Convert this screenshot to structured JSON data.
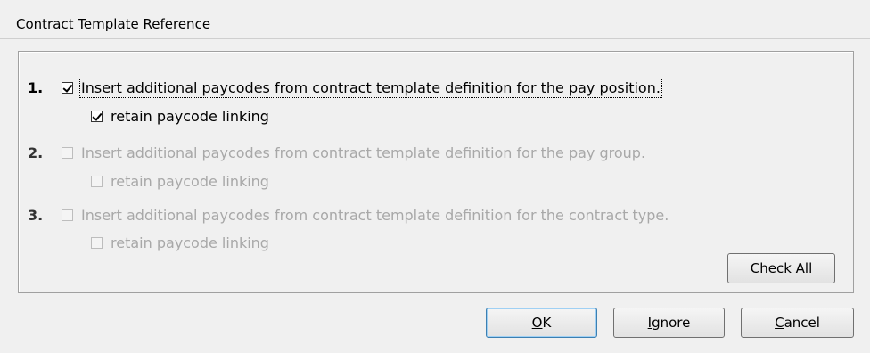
{
  "window": {
    "title": "Contract Template Reference"
  },
  "options": [
    {
      "number": "1.",
      "label": "Insert additional paycodes from contract template definition for the pay position.",
      "checked": true,
      "enabled": true,
      "sub_label": "retain paycode linking",
      "sub_checked": true
    },
    {
      "number": "2.",
      "label": "Insert additional paycodes from contract template definition for the pay group.",
      "checked": false,
      "enabled": false,
      "sub_label": "retain paycode linking",
      "sub_checked": false
    },
    {
      "number": "3.",
      "label": "Insert additional paycodes from contract template definition for the contract type.",
      "checked": false,
      "enabled": false,
      "sub_label": "retain paycode linking",
      "sub_checked": false
    }
  ],
  "buttons": {
    "check_all": "Check All",
    "ok": {
      "accel": "O",
      "rest": "K"
    },
    "ignore": {
      "accel": "I",
      "rest": "gnore"
    },
    "cancel": {
      "accel": "C",
      "rest": "ancel"
    }
  }
}
